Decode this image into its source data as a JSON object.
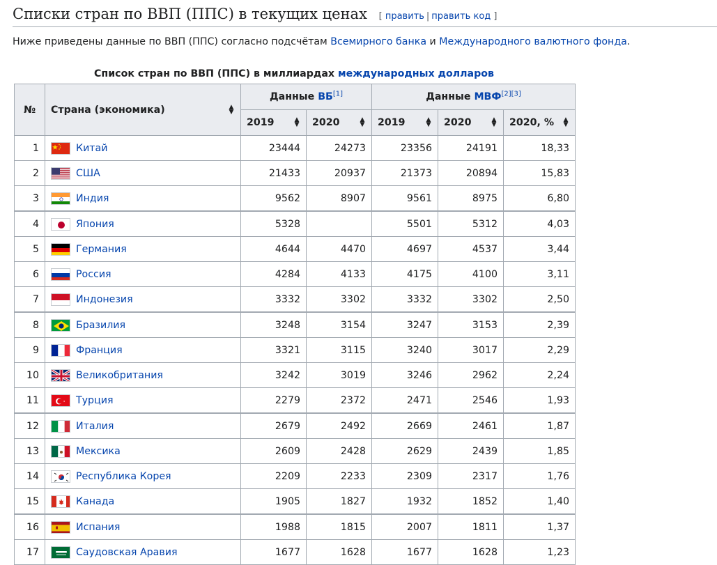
{
  "section": {
    "title": "Списки стран по ВВП (ППС) в текущих ценах",
    "edit_open": "[",
    "edit_label": "править",
    "edit_div": "|",
    "edit_code_label": "править код",
    "edit_close": "]"
  },
  "intro": {
    "before": "Ниже приведены данные по ВВП (ППС) согласно подсчётам ",
    "link1": "Всемирного банка",
    "middle": " и ",
    "link2": "Международного валютного фонда",
    "after": "."
  },
  "caption": {
    "text": "Список стран по ВВП (ППС) в миллиардах ",
    "link": "международных долларов"
  },
  "headers": {
    "rank": "№",
    "country": "Страна (экономика)",
    "wb_prefix": "Данные ",
    "wb_link": "ВБ",
    "wb_ref": "[1]",
    "imf_prefix": "Данные ",
    "imf_link": "МВФ",
    "imf_ref": "[2][3]",
    "y2019": "2019",
    "y2020": "2020",
    "imf2019": "2019",
    "imf2020": "2020",
    "share": "2020, %"
  },
  "colors": {
    "link": "#0645ad",
    "header_bg": "#eaecf0",
    "border": "#a2a9b1"
  },
  "rows": [
    {
      "rank": "1",
      "country": "Китай",
      "flag": "cn",
      "wb2019": "23444",
      "wb2020": "24273",
      "imf2019": "23356",
      "imf2020": "24191",
      "share": "18,33"
    },
    {
      "rank": "2",
      "country": "США",
      "flag": "us",
      "wb2019": "21433",
      "wb2020": "20937",
      "imf2019": "21373",
      "imf2020": "20894",
      "share": "15,83"
    },
    {
      "rank": "3",
      "country": "Индия",
      "flag": "in",
      "wb2019": "9562",
      "wb2020": "8907",
      "imf2019": "9561",
      "imf2020": "8975",
      "share": "6,80"
    },
    {
      "rank": "4",
      "country": "Япония",
      "flag": "jp",
      "wb2019": "5328",
      "wb2020": "",
      "imf2019": "5501",
      "imf2020": "5312",
      "share": "4,03"
    },
    {
      "rank": "5",
      "country": "Германия",
      "flag": "de",
      "wb2019": "4644",
      "wb2020": "4470",
      "imf2019": "4697",
      "imf2020": "4537",
      "share": "3,44"
    },
    {
      "rank": "6",
      "country": "Россия",
      "flag": "ru",
      "wb2019": "4284",
      "wb2020": "4133",
      "imf2019": "4175",
      "imf2020": "4100",
      "share": "3,11"
    },
    {
      "rank": "7",
      "country": "Индонезия",
      "flag": "id",
      "wb2019": "3332",
      "wb2020": "3302",
      "imf2019": "3332",
      "imf2020": "3302",
      "share": "2,50"
    },
    {
      "rank": "8",
      "country": "Бразилия",
      "flag": "br",
      "wb2019": "3248",
      "wb2020": "3154",
      "imf2019": "3247",
      "imf2020": "3153",
      "share": "2,39"
    },
    {
      "rank": "9",
      "country": "Франция",
      "flag": "fr",
      "wb2019": "3321",
      "wb2020": "3115",
      "imf2019": "3240",
      "imf2020": "3017",
      "share": "2,29"
    },
    {
      "rank": "10",
      "country": "Великобритания",
      "flag": "gb",
      "wb2019": "3242",
      "wb2020": "3019",
      "imf2019": "3246",
      "imf2020": "2962",
      "share": "2,24"
    },
    {
      "rank": "11",
      "country": "Турция",
      "flag": "tr",
      "wb2019": "2279",
      "wb2020": "2372",
      "imf2019": "2471",
      "imf2020": "2546",
      "share": "1,93"
    },
    {
      "rank": "12",
      "country": "Италия",
      "flag": "it",
      "wb2019": "2679",
      "wb2020": "2492",
      "imf2019": "2669",
      "imf2020": "2461",
      "share": "1,87"
    },
    {
      "rank": "13",
      "country": "Мексика",
      "flag": "mx",
      "wb2019": "2609",
      "wb2020": "2428",
      "imf2019": "2629",
      "imf2020": "2439",
      "share": "1,85"
    },
    {
      "rank": "14",
      "country": "Республика Корея",
      "flag": "kr",
      "wb2019": "2209",
      "wb2020": "2233",
      "imf2019": "2309",
      "imf2020": "2317",
      "share": "1,76"
    },
    {
      "rank": "15",
      "country": "Канада",
      "flag": "ca",
      "wb2019": "1905",
      "wb2020": "1827",
      "imf2019": "1932",
      "imf2020": "1852",
      "share": "1,40"
    },
    {
      "rank": "16",
      "country": "Испания",
      "flag": "es",
      "wb2019": "1988",
      "wb2020": "1815",
      "imf2019": "2007",
      "imf2020": "1811",
      "share": "1,37"
    },
    {
      "rank": "17",
      "country": "Саудовская Аравия",
      "flag": "sa",
      "wb2019": "1677",
      "wb2020": "1628",
      "imf2019": "1677",
      "imf2020": "1628",
      "share": "1,23"
    }
  ]
}
